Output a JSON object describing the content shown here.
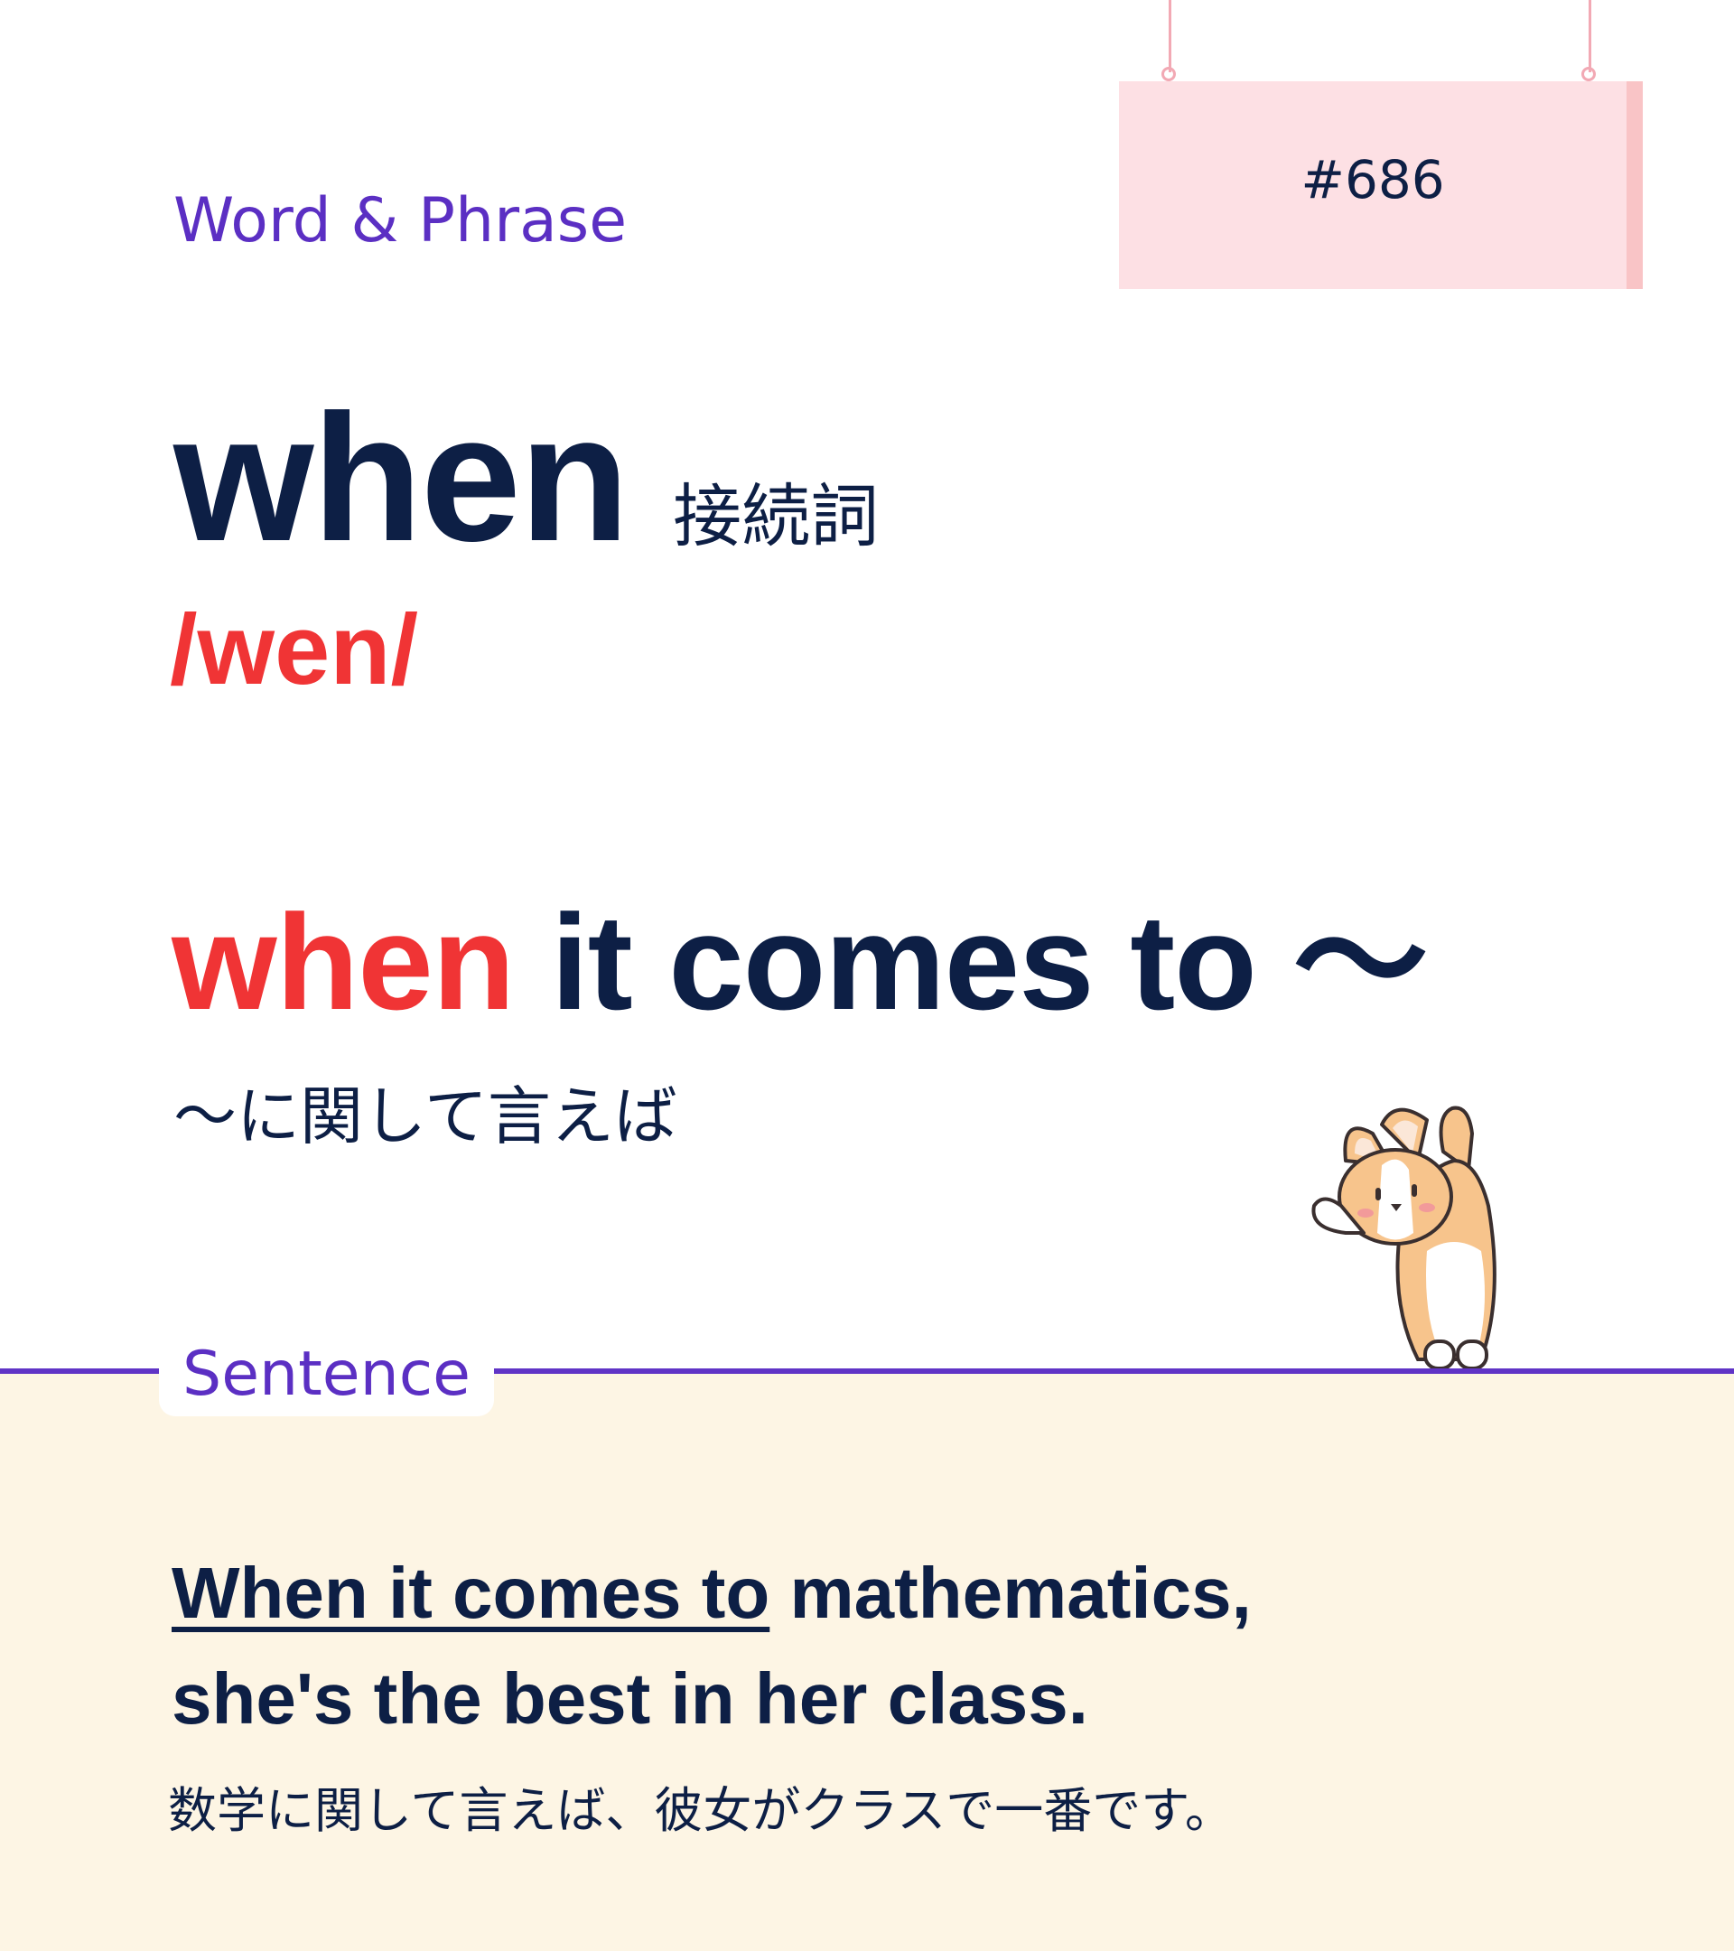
{
  "header": {
    "category_label": "Word & Phrase",
    "sign_number": "#686"
  },
  "entry": {
    "word": "when",
    "part_of_speech": "接続詞",
    "pronunciation": "/wen/"
  },
  "phrase": {
    "highlight": "when",
    "rest": " it comes to ～",
    "meaning": "～に関して言えば"
  },
  "sentence_section": {
    "label": "Sentence",
    "example_underlined": "When it comes to",
    "example_line1_rest": " mathematics,",
    "example_line2": "she's the best in her class.",
    "translation": "数学に関して言えば、彼女がクラスで一番です。"
  },
  "colors": {
    "navy": "#0d1f45",
    "accent_red": "#f03435",
    "purple": "#5b2fc3",
    "sign_pink": "#fde0e4",
    "sentence_bg": "#fdf5e4"
  },
  "illustration": "corgi-mascot"
}
